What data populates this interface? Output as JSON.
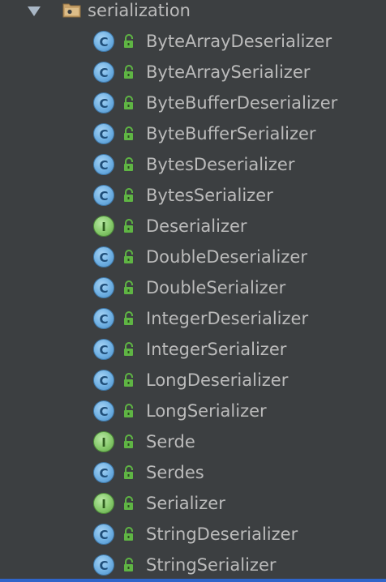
{
  "package": {
    "name": "serialization",
    "expanded": true,
    "icon": "package-folder-icon"
  },
  "items": [
    {
      "label": "ByteArrayDeserializer",
      "kind": "class",
      "kind_letter": "C"
    },
    {
      "label": "ByteArraySerializer",
      "kind": "class",
      "kind_letter": "C"
    },
    {
      "label": "ByteBufferDeserializer",
      "kind": "class",
      "kind_letter": "C"
    },
    {
      "label": "ByteBufferSerializer",
      "kind": "class",
      "kind_letter": "C"
    },
    {
      "label": "BytesDeserializer",
      "kind": "class",
      "kind_letter": "C"
    },
    {
      "label": "BytesSerializer",
      "kind": "class",
      "kind_letter": "C"
    },
    {
      "label": "Deserializer",
      "kind": "interface",
      "kind_letter": "I"
    },
    {
      "label": "DoubleDeserializer",
      "kind": "class",
      "kind_letter": "C"
    },
    {
      "label": "DoubleSerializer",
      "kind": "class",
      "kind_letter": "C"
    },
    {
      "label": "IntegerDeserializer",
      "kind": "class",
      "kind_letter": "C"
    },
    {
      "label": "IntegerSerializer",
      "kind": "class",
      "kind_letter": "C"
    },
    {
      "label": "LongDeserializer",
      "kind": "class",
      "kind_letter": "C"
    },
    {
      "label": "LongSerializer",
      "kind": "class",
      "kind_letter": "C"
    },
    {
      "label": "Serde",
      "kind": "interface",
      "kind_letter": "I"
    },
    {
      "label": "Serdes",
      "kind": "class",
      "kind_letter": "C"
    },
    {
      "label": "Serializer",
      "kind": "interface",
      "kind_letter": "I"
    },
    {
      "label": "StringDeserializer",
      "kind": "class",
      "kind_letter": "C"
    },
    {
      "label": "StringSerializer",
      "kind": "class",
      "kind_letter": "C"
    }
  ],
  "colors": {
    "background": "#3c3f41",
    "text": "#bbbbbb",
    "class_icon": "#6fb0e3",
    "interface_icon": "#86c96b",
    "lock_icon": "#5fb544",
    "selection_bar": "#2f65ca"
  }
}
